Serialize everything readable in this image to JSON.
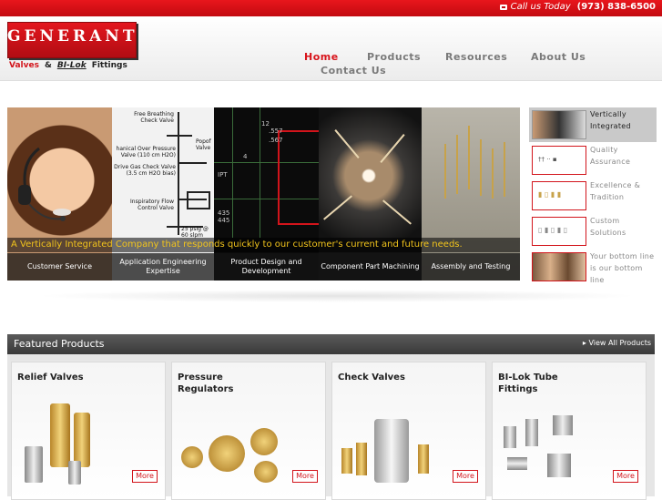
{
  "topbar": {
    "call_label": "Call us Today",
    "phone": "(973) 838-6500"
  },
  "logo": {
    "brand": "GENERANT",
    "valves": "Valves",
    "amp": "&",
    "bilok": "BI-Lok",
    "fittings": "Fittings"
  },
  "nav": [
    {
      "label": "Home",
      "active": true
    },
    {
      "label": "Products",
      "active": false
    },
    {
      "label": "Resources",
      "active": false
    },
    {
      "label": "About Us",
      "active": false
    },
    {
      "label": "Contact Us",
      "active": false
    }
  ],
  "hero": {
    "tagline": "A Vertically Integrated Company that responds quickly to our customer's current and future needs.",
    "captions": [
      "Customer Service",
      "Application Engineering Expertise",
      "Product Design and Development",
      "Component Part Machining",
      "Assembly and Testing"
    ],
    "schematic_labels": [
      "Free Breathing Check Valve",
      "hanical Over Pressure Valve (110 cm H2O)",
      "Drive Gas Check Valve (3.5 cm H2O bias)",
      "Inspiratory Flow Control Valve",
      "25 psig @ 60 slpm",
      "Popof Valve"
    ],
    "drawing_labels": [
      "12",
      ".557",
      ".567",
      "4",
      "IPT",
      "435",
      "445"
    ]
  },
  "thumbs": [
    {
      "label": "Vertically Integrated",
      "active": true
    },
    {
      "label": "Quality Assurance",
      "active": false
    },
    {
      "label": "Excellence & Tradition",
      "active": false
    },
    {
      "label": "Custom Solutions",
      "active": false
    },
    {
      "label": "Your bottom line is our bottom line",
      "active": false
    }
  ],
  "featured": {
    "title": "Featured Products",
    "view_all": "▸ View All Products",
    "products": [
      {
        "name": "Relief Valves",
        "more": "More"
      },
      {
        "name": "Pressure Regulators",
        "more": "More"
      },
      {
        "name": "Check Valves",
        "more": "More"
      },
      {
        "name": "BI-Lok Tube Fittings",
        "more": "More"
      }
    ]
  },
  "colors": {
    "brand_red": "#d2141b",
    "tagline_yellow": "#f2c41c",
    "featured_bar": "#4a4a4a"
  }
}
